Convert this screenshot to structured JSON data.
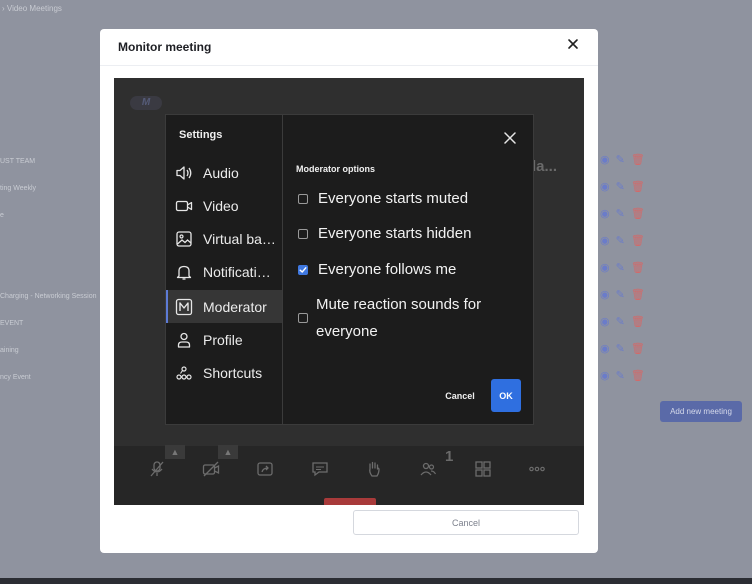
{
  "background": {
    "breadcrumb": "› Video Meetings",
    "rows": [
      "UST TEAM",
      "ting Weekly",
      "e",
      "",
      "",
      "Charging - Networking Session",
      "EVENT",
      "aining",
      "ncy Event"
    ],
    "add_button": "Add new meeting"
  },
  "modal": {
    "title": "Monitor meeting",
    "cancel_label": "Cancel",
    "behind_logo": "M",
    "behind_name": "la..."
  },
  "toolbar": {
    "participant_count": "1",
    "icons": [
      "mic-muted-icon",
      "camera-off-icon",
      "share-screen-icon",
      "chat-icon",
      "raise-hand-icon",
      "participants-icon",
      "tile-view-icon",
      "more-icon"
    ]
  },
  "settings": {
    "title": "Settings",
    "items": [
      {
        "label": "Audio",
        "icon": "speaker-icon"
      },
      {
        "label": "Video",
        "icon": "video-camera-icon"
      },
      {
        "label": "Virtual background",
        "icon": "image-icon"
      },
      {
        "label": "Notifications",
        "icon": "bell-icon"
      },
      {
        "label": "Moderator",
        "icon": "moderator-icon"
      },
      {
        "label": "Profile",
        "icon": "person-icon"
      },
      {
        "label": "Shortcuts",
        "icon": "shortcuts-icon"
      }
    ],
    "active_item": "Moderator",
    "section_title": "Moderator options",
    "options": [
      {
        "label": "Everyone starts muted",
        "checked": false
      },
      {
        "label": "Everyone starts hidden",
        "checked": false
      },
      {
        "label": "Everyone follows me",
        "checked": true
      },
      {
        "label": "Mute reaction sounds for everyone",
        "checked": false
      }
    ],
    "cancel_label": "Cancel",
    "ok_label": "OK",
    "accent_color": "#2f6fe0"
  }
}
